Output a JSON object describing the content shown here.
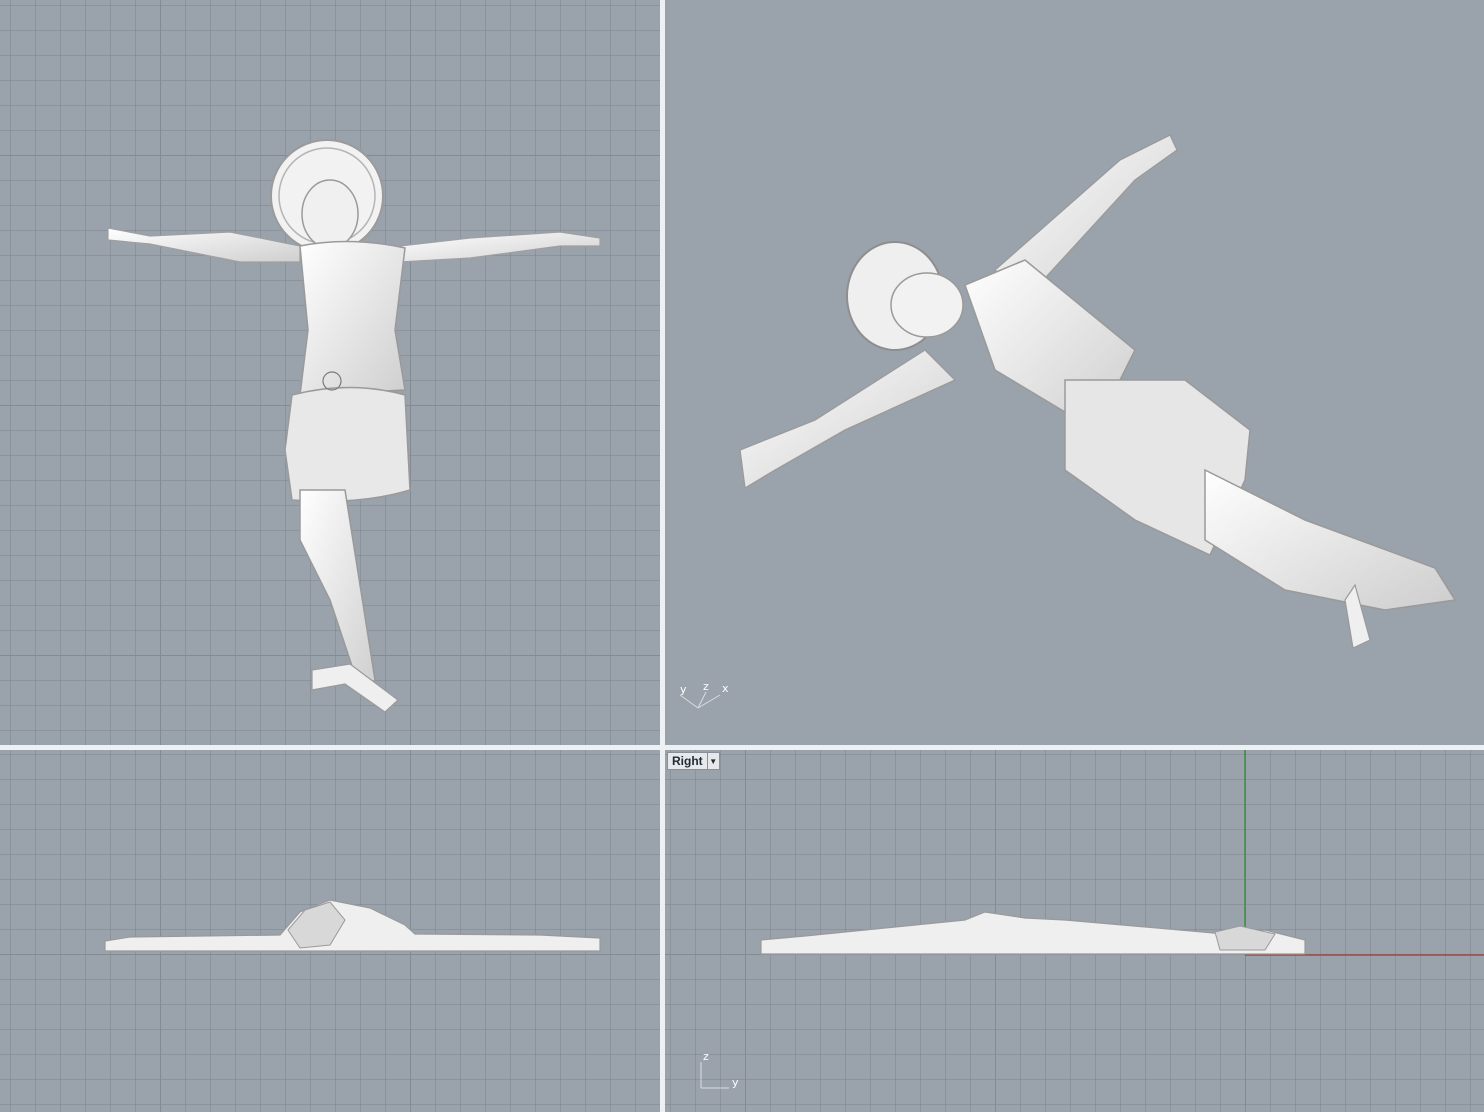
{
  "viewports": {
    "top": {},
    "perspective": {
      "axis_labels": {
        "x": "x",
        "y": "y",
        "z": "z"
      }
    },
    "front": {},
    "right": {
      "label": "Right",
      "axis_labels": {
        "y": "y",
        "z": "z"
      }
    }
  },
  "colors": {
    "viewport_bg": "#9aa2ab",
    "grid_major": "#828a93",
    "model": "#ebebeb",
    "x_axis": "#a33a30",
    "y_axis": "#2d8a2d",
    "separator": "#eef1f4"
  },
  "icons": {
    "dropdown": "chevron-down-icon"
  }
}
